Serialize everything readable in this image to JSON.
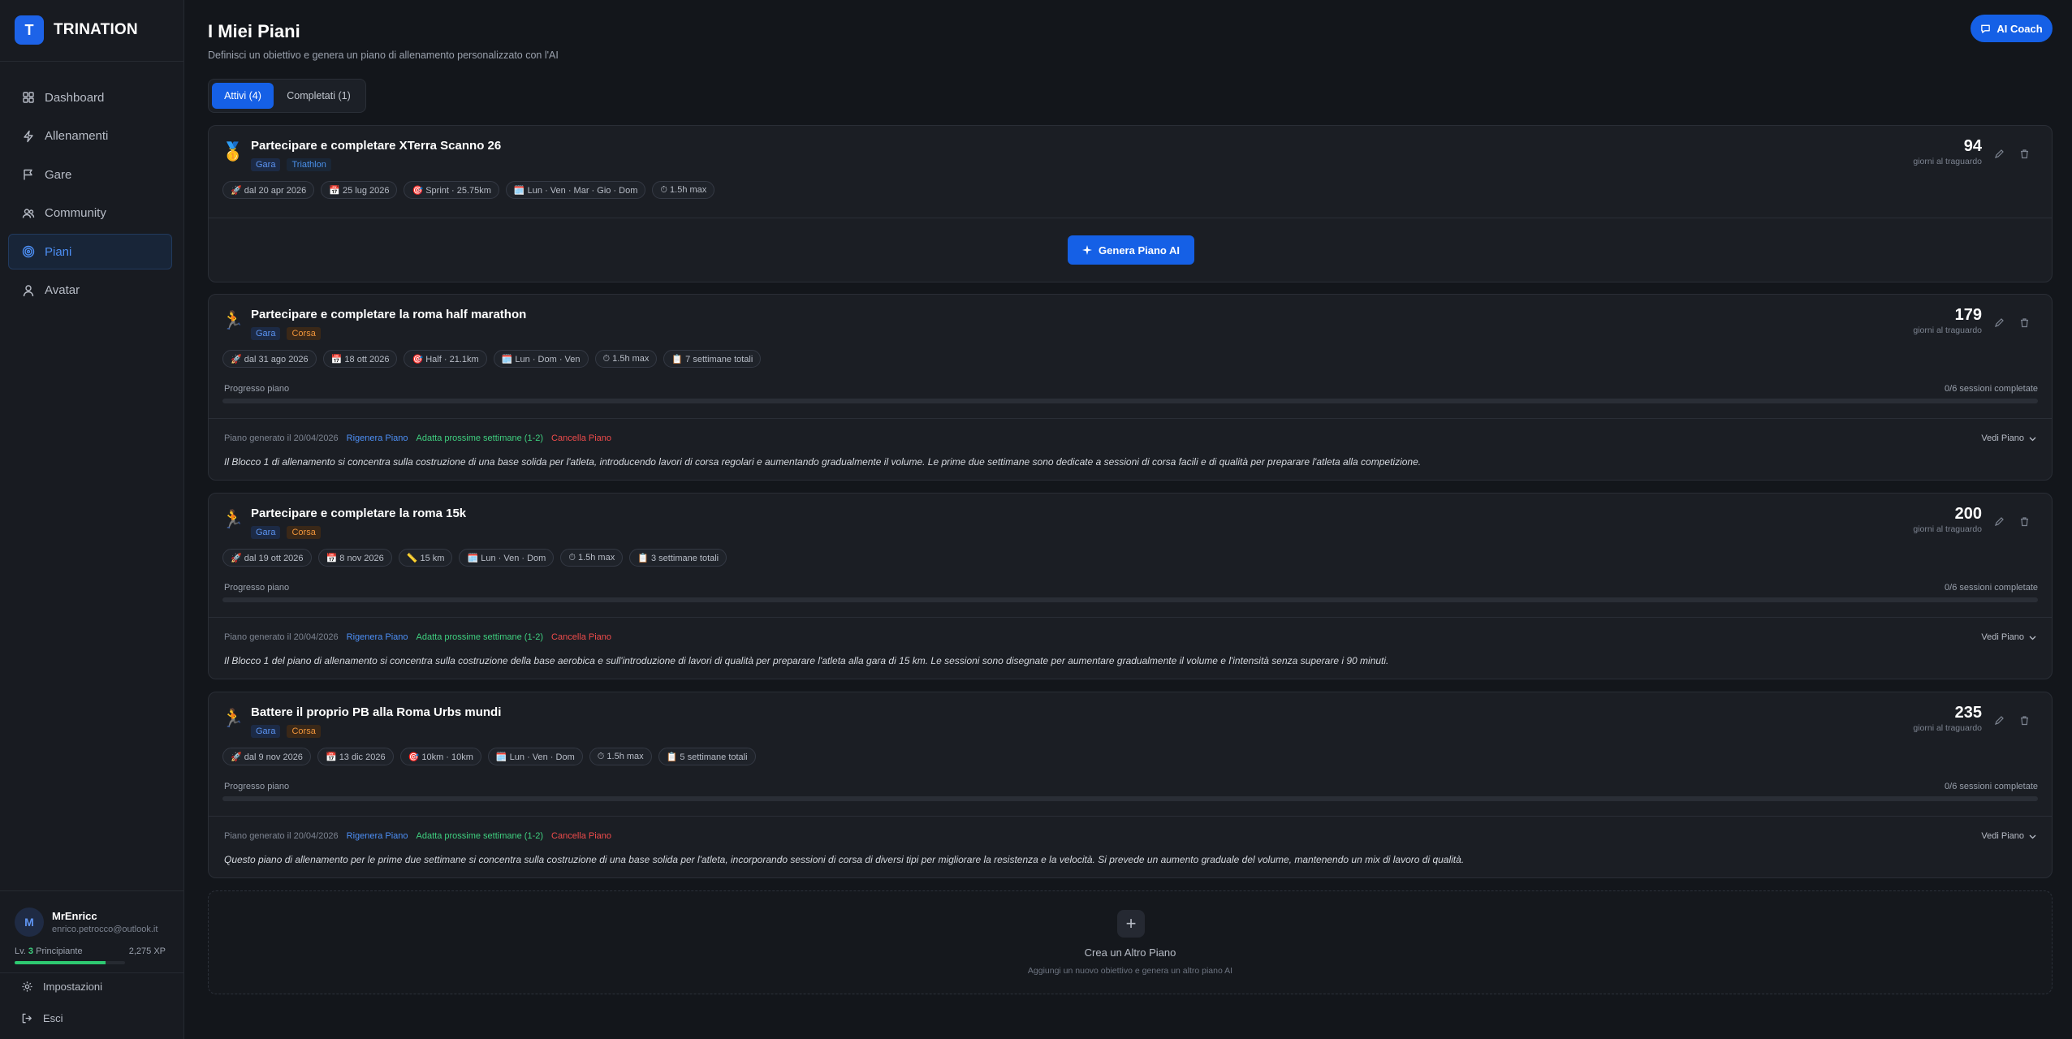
{
  "brand": {
    "logo_letter": "T",
    "name": "TRINATION",
    "accent": "#1d63e8"
  },
  "sidebar": {
    "items": [
      {
        "label": "Dashboard",
        "icon": "grid-icon",
        "active": false
      },
      {
        "label": "Allenamenti",
        "icon": "bolt-icon",
        "active": false
      },
      {
        "label": "Gare",
        "icon": "flag-icon",
        "active": false
      },
      {
        "label": "Community",
        "icon": "users-icon",
        "active": false
      },
      {
        "label": "Piani",
        "icon": "target-icon",
        "active": true
      },
      {
        "label": "Avatar",
        "icon": "user-icon",
        "active": false
      }
    ],
    "user": {
      "initial": "M",
      "name": "MrEnricc",
      "email": "enrico.petrocco@outlook.it",
      "level_prefix": "Lv.",
      "level_num": "3",
      "level_name": "Principiante",
      "xp": "2,275 XP",
      "xp_progress": 0.82
    },
    "settings_label": "Impostazioni",
    "logout_label": "Esci"
  },
  "header": {
    "title": "I Miei Piani",
    "subtitle": "Definisci un obiettivo e genera un piano di allenamento personalizzato con l'AI",
    "ai_coach_label": "AI Coach"
  },
  "tabs": [
    {
      "label": "Attivi (4)",
      "active": true
    },
    {
      "label": "Completati (1)",
      "active": false
    }
  ],
  "plans": [
    {
      "icon": "🥇",
      "title": "Partecipare e completare XTerra Scanno 26",
      "tags": [
        "Gara",
        "Triathlon"
      ],
      "chips": [
        "🚀 dal 20 apr 2026",
        "📅 25 lug 2026",
        "🎯 Sprint · 25.75km",
        "🗓️ Lun · Ven · Mar · Gio · Dom",
        "⏱ 1.5h max"
      ],
      "days": "94",
      "days_label": "giorni al traguardo",
      "generate_label": "Genera Piano AI"
    },
    {
      "icon": "🏃",
      "title": "Partecipare e completare la roma half marathon",
      "tags": [
        "Gara",
        "Corsa"
      ],
      "chips": [
        "🚀 dal 31 ago 2026",
        "📅 18 ott 2026",
        "🎯 Half · 21.1km",
        "🗓️ Lun · Dom · Ven",
        "⏱ 1.5h max",
        "📋 7 settimane totali"
      ],
      "days": "179",
      "days_label": "giorni al traguardo",
      "progress_label": "Progresso piano",
      "progress_text": "0/6 sessioni completate",
      "progress": 0,
      "generated": "Piano generato il 20/04/2026",
      "regen_label": "Rigenera Piano",
      "adapt_label": "Adatta prossime settimane (1-2)",
      "cancel_label": "Cancella Piano",
      "view_label": "Vedi Piano",
      "summary": "Il Blocco 1 di allenamento si concentra sulla costruzione di una base solida per l'atleta, introducendo lavori di corsa regolari e aumentando gradualmente il volume. Le prime due settimane sono dedicate a sessioni di corsa facili e di qualità per preparare l'atleta alla competizione."
    },
    {
      "icon": "🏃",
      "title": "Partecipare e completare la roma 15k",
      "tags": [
        "Gara",
        "Corsa"
      ],
      "chips": [
        "🚀 dal 19 ott 2026",
        "📅 8 nov 2026",
        "📏 15 km",
        "🗓️ Lun · Ven · Dom",
        "⏱ 1.5h max",
        "📋 3 settimane totali"
      ],
      "days": "200",
      "days_label": "giorni al traguardo",
      "progress_label": "Progresso piano",
      "progress_text": "0/6 sessioni completate",
      "progress": 0,
      "generated": "Piano generato il 20/04/2026",
      "regen_label": "Rigenera Piano",
      "adapt_label": "Adatta prossime settimane (1-2)",
      "cancel_label": "Cancella Piano",
      "view_label": "Vedi Piano",
      "summary": "Il Blocco 1 del piano di allenamento si concentra sulla costruzione della base aerobica e sull'introduzione di lavori di qualità per preparare l'atleta alla gara di 15 km. Le sessioni sono disegnate per aumentare gradualmente il volume e l'intensità senza superare i 90 minuti."
    },
    {
      "icon": "🏃",
      "title": "Battere il proprio PB alla Roma Urbs mundi",
      "tags": [
        "Gara",
        "Corsa"
      ],
      "chips": [
        "🚀 dal 9 nov 2026",
        "📅 13 dic 2026",
        "🎯 10km · 10km",
        "🗓️ Lun · Ven · Dom",
        "⏱ 1.5h max",
        "📋 5 settimane totali"
      ],
      "days": "235",
      "days_label": "giorni al traguardo",
      "progress_label": "Progresso piano",
      "progress_text": "0/6 sessioni completate",
      "progress": 0,
      "generated": "Piano generato il 20/04/2026",
      "regen_label": "Rigenera Piano",
      "adapt_label": "Adatta prossime settimane (1-2)",
      "cancel_label": "Cancella Piano",
      "view_label": "Vedi Piano",
      "summary": "Questo piano di allenamento per le prime due settimane si concentra sulla costruzione di una base solida per l'atleta, incorporando sessioni di corsa di diversi tipi per migliorare la resistenza e la velocità. Si prevede un aumento graduale del volume, mantenendo un mix di lavoro di qualità."
    }
  ],
  "create": {
    "plus": "+",
    "title": "Crea un Altro Piano",
    "subtitle": "Aggiungi un nuovo obiettivo e genera un altro piano AI"
  }
}
